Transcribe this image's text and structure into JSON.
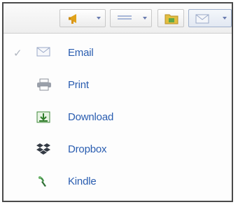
{
  "toolbar": {
    "buttons": [
      {
        "name": "announce",
        "icon": "megaphone-icon",
        "color": "#e0a21a"
      },
      {
        "name": "format",
        "icon": "lines-icon",
        "color": "#a9b8d8"
      },
      {
        "name": "folder",
        "icon": "folder-icon",
        "color": "#d7b23a"
      },
      {
        "name": "share",
        "icon": "envelope-icon",
        "color": "#9aa9c8"
      }
    ]
  },
  "menu": {
    "items": [
      {
        "label": "Email",
        "icon": "envelope-icon",
        "checked": true
      },
      {
        "label": "Print",
        "icon": "printer-icon",
        "checked": false
      },
      {
        "label": "Download",
        "icon": "download-icon",
        "checked": false
      },
      {
        "label": "Dropbox",
        "icon": "dropbox-icon",
        "checked": false
      },
      {
        "label": "Kindle",
        "icon": "kindle-icon",
        "checked": false
      }
    ],
    "check_glyph": "✓",
    "label_color": "#2a5db0"
  }
}
